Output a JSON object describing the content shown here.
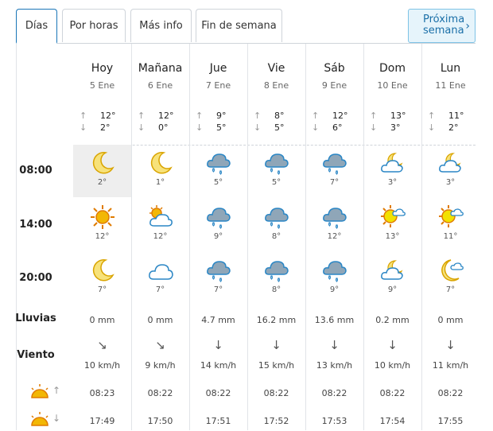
{
  "tabs": [
    "Días",
    "Por horas",
    "Más info",
    "Fin de semana"
  ],
  "next_week": [
    "Próxima",
    "semana"
  ],
  "next_arrow": "›",
  "row_labels": {
    "h1": "08:00",
    "h2": "14:00",
    "h3": "20:00",
    "rain": "Lluvias",
    "wind": "Viento"
  },
  "arrow_up": "↑",
  "arrow_down": "↓",
  "days": [
    {
      "name": "Hoy",
      "date": "5 Ene",
      "max": "12°",
      "min": "2°",
      "slots": [
        {
          "icon": "moon",
          "temp": "2°"
        },
        {
          "icon": "sun",
          "temp": "12°"
        },
        {
          "icon": "moon",
          "temp": "7°"
        }
      ],
      "rain": "0 mm",
      "wind_dir": "↘",
      "wind": "10 km/h",
      "sunrise": "08:23",
      "sunset": "17:49"
    },
    {
      "name": "Mañana",
      "date": "6 Ene",
      "max": "12°",
      "min": "0°",
      "slots": [
        {
          "icon": "moon",
          "temp": "1°"
        },
        {
          "icon": "sun-cloud",
          "temp": "12°"
        },
        {
          "icon": "cloud",
          "temp": "7°"
        }
      ],
      "rain": "0 mm",
      "wind_dir": "↘",
      "wind": "9 km/h",
      "sunrise": "08:22",
      "sunset": "17:50"
    },
    {
      "name": "Jue",
      "date": "7 Ene",
      "max": "9°",
      "min": "5°",
      "slots": [
        {
          "icon": "rain",
          "temp": "5°"
        },
        {
          "icon": "rain",
          "temp": "9°"
        },
        {
          "icon": "rain",
          "temp": "7°"
        }
      ],
      "rain": "4.7 mm",
      "wind_dir": "↓",
      "wind": "14 km/h",
      "sunrise": "08:22",
      "sunset": "17:51"
    },
    {
      "name": "Vie",
      "date": "8 Ene",
      "max": "8°",
      "min": "5°",
      "slots": [
        {
          "icon": "rain",
          "temp": "5°"
        },
        {
          "icon": "rain",
          "temp": "8°"
        },
        {
          "icon": "rain",
          "temp": "8°"
        }
      ],
      "rain": "16.2 mm",
      "wind_dir": "↓",
      "wind": "15 km/h",
      "sunrise": "08:22",
      "sunset": "17:52"
    },
    {
      "name": "Sáb",
      "date": "9 Ene",
      "max": "12°",
      "min": "6°",
      "slots": [
        {
          "icon": "rain",
          "temp": "7°"
        },
        {
          "icon": "rain",
          "temp": "12°"
        },
        {
          "icon": "rain",
          "temp": "9°"
        }
      ],
      "rain": "13.6 mm",
      "wind_dir": "↓",
      "wind": "13 km/h",
      "sunrise": "08:22",
      "sunset": "17:53"
    },
    {
      "name": "Dom",
      "date": "10 Ene",
      "max": "13°",
      "min": "3°",
      "slots": [
        {
          "icon": "moon-cloud",
          "temp": "3°"
        },
        {
          "icon": "sun-cloud-small",
          "temp": "13°"
        },
        {
          "icon": "moon-cloud",
          "temp": "9°"
        }
      ],
      "rain": "0.2 mm",
      "wind_dir": "↓",
      "wind": "10 km/h",
      "sunrise": "08:22",
      "sunset": "17:54"
    },
    {
      "name": "Lun",
      "date": "11 Ene",
      "max": "11°",
      "min": "2°",
      "slots": [
        {
          "icon": "moon-cloud",
          "temp": "3°"
        },
        {
          "icon": "sun-cloud-small",
          "temp": "11°"
        },
        {
          "icon": "moon-cloud-big",
          "temp": "7°"
        }
      ],
      "rain": "0 mm",
      "wind_dir": "↓",
      "wind": "11 km/h",
      "sunrise": "08:22",
      "sunset": "17:55"
    }
  ]
}
